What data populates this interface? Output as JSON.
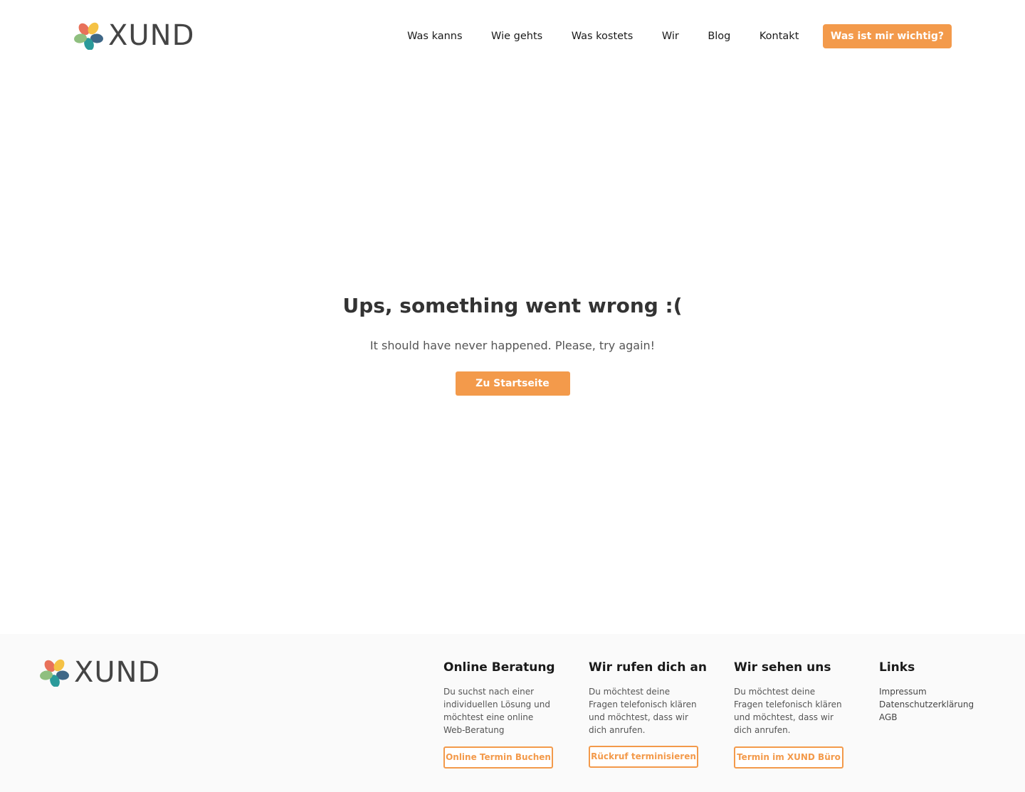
{
  "brand": {
    "name": "XUND",
    "petal_colors": [
      "#e8715a",
      "#f5c245",
      "#3e6787",
      "#8fbf7f",
      "#2a9a9a"
    ],
    "accent": "#f39a4b"
  },
  "nav": {
    "items": [
      {
        "label": "Was kanns"
      },
      {
        "label": "Wie gehts"
      },
      {
        "label": "Was kostets"
      },
      {
        "label": "Wir"
      },
      {
        "label": "Blog"
      },
      {
        "label": "Kontakt"
      }
    ],
    "cta_label": "Was ist mir wichtig?"
  },
  "error": {
    "title": "Ups, something went wrong :(",
    "message": "It should have never happened. Please, try again!",
    "button_label": "Zu Startseite"
  },
  "footer": {
    "columns": [
      {
        "title": "Online Beratung",
        "text": "Du suchst nach einer individuellen Lösung und möchtest eine online Web-Beratung",
        "button_label": "Online Termin Buchen"
      },
      {
        "title": "Wir rufen dich an",
        "text": "Du möchtest deine Fragen telefonisch klären und möchtest, dass wir dich anrufen.",
        "button_label": "Rückruf terminisieren"
      },
      {
        "title": "Wir sehen uns",
        "text": "Du möchtest deine Fragen telefonisch klären und möchtest, dass wir dich anrufen.",
        "button_label": "Termin im XUND Büro"
      }
    ],
    "links": {
      "title": "Links",
      "items": [
        "Impressum",
        "Datenschutzerklärung",
        "AGB"
      ]
    }
  }
}
